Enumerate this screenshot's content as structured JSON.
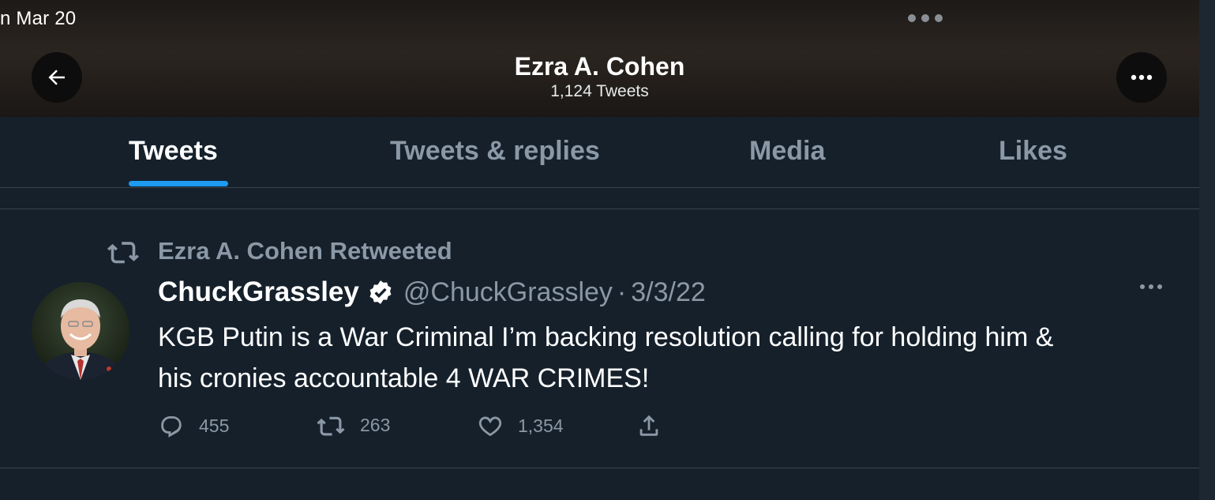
{
  "status_bar": {
    "date_text": "n Mar 20"
  },
  "header": {
    "name": "Ezra A. Cohen",
    "tweet_count": "1,124 Tweets"
  },
  "tabs": [
    {
      "label": "Tweets",
      "active": true
    },
    {
      "label": "Tweets & replies",
      "active": false
    },
    {
      "label": "Media",
      "active": false
    },
    {
      "label": "Likes",
      "active": false
    }
  ],
  "tweet": {
    "retweet_label": "Ezra A. Cohen Retweeted",
    "author_name": "ChuckGrassley",
    "handle": "@ChuckGrassley",
    "separator": "·",
    "date": "3/3/22",
    "text_line1": "KGB Putin is a War Criminal I’m backing resolution calling for holding him &",
    "text_line2": "his cronies accountable 4 WAR CRIMES!",
    "replies": "455",
    "retweets": "263",
    "likes": "1,354"
  },
  "colors": {
    "background": "#15202b",
    "accent": "#1d9bf0",
    "secondary_text": "#8b98a5",
    "divider": "#38444d"
  },
  "icons": [
    "arrow-left-icon",
    "more-horizontal-icon",
    "retweet-icon",
    "verified-badge-icon",
    "reply-icon",
    "like-icon",
    "share-icon"
  ]
}
